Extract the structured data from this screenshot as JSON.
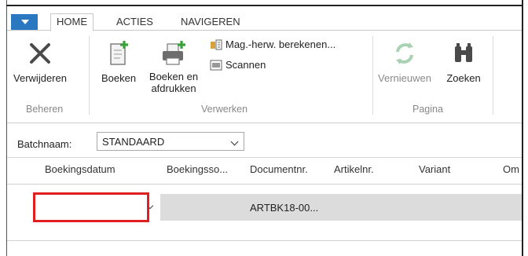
{
  "ribbon": {
    "tabs": [
      {
        "label": "HOME",
        "active": true
      },
      {
        "label": "ACTIES",
        "active": false
      },
      {
        "label": "NAVIGEREN",
        "active": false
      }
    ],
    "groups": {
      "beheren": {
        "label": "Beheren",
        "buttons": [
          {
            "label": "Verwijderen",
            "icon": "delete-x-icon"
          }
        ]
      },
      "verwerken": {
        "label": "Verwerken",
        "buttons": [
          {
            "label": "Boeken",
            "icon": "post-icon"
          },
          {
            "label_line1": "Boeken en",
            "label_line2": "afdrukken",
            "icon": "post-print-icon"
          }
        ],
        "small_buttons": [
          {
            "label": "Mag.-herw. berekenen...",
            "icon": "calculate-inventory-icon"
          },
          {
            "label": "Scannen",
            "icon": "barcode-scan-icon"
          }
        ]
      },
      "pagina": {
        "label": "Pagina",
        "buttons": [
          {
            "label": "Vernieuwen",
            "icon": "refresh-icon",
            "disabled": true
          },
          {
            "label": "Zoeken",
            "icon": "binoculars-icon"
          }
        ]
      }
    }
  },
  "batch": {
    "label": "Batchnaam:",
    "value": "STANDAARD"
  },
  "grid": {
    "columns": [
      "Boekingsdatum",
      "Boekingsso...",
      "Documentnr.",
      "Artikelnr.",
      "Variant",
      "Om"
    ],
    "rows": [
      {
        "boekingsdatum": "",
        "boekingssoort": "",
        "documentnr": "ARTBK18-00...",
        "artikelnr": "",
        "variant": ""
      }
    ]
  },
  "colors": {
    "accent": "#2b78c2",
    "highlight_border": "#e02020",
    "selected_row": "#dcdcdc"
  }
}
